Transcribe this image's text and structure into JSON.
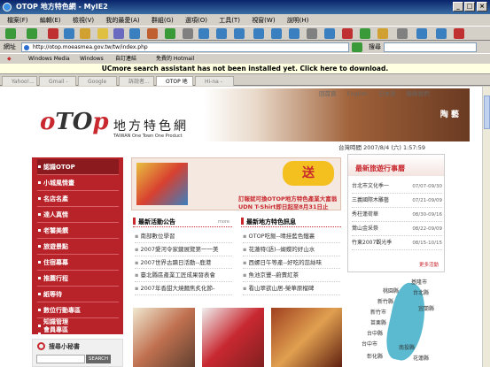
{
  "window": {
    "title": "OTOP 地方特色網 - MyIE2"
  },
  "menu": [
    "檔案(F)",
    "編輯(E)",
    "檢視(V)",
    "我的最愛(A)",
    "群組(G)",
    "選項(O)",
    "工具(T)",
    "視窗(W)",
    "說明(H)"
  ],
  "address": {
    "label": "網址",
    "url": "http://otop.moeasmea.gov.tw/tw/index.php",
    "search_label": "搜尋"
  },
  "links": [
    "Windows Media",
    "Windows",
    "自訂連結",
    "免費的 Hotmail"
  ],
  "infobar": "UCmore search assistant has not been installed yet. Click here to download.",
  "tabs": [
    "Yahoo!...",
    "Gmail - R...",
    "Google R...",
    "訴說者...",
    "OTOP 地方...",
    "Hi-na - Pu..."
  ],
  "site": {
    "topnav": [
      "回首頁",
      "English",
      "日本語",
      "聯絡我們"
    ],
    "logo_o": "o",
    "logo_t": "TO",
    "logo_p": "p",
    "name": "地方特色網",
    "tagline": "TAIWAN One Town One Product",
    "banner_text": "陶 藝",
    "clock": "台灣時間 2007/8/4 (六) 1:57:59"
  },
  "leftnav": [
    "認識OTOP",
    "小城風情畫",
    "名店名產",
    "達人真情",
    "老饕美饌",
    "旅遊景點",
    "住宿幕幕",
    "推薦行程",
    "紙等待",
    "數位行動專區",
    "知識管理",
    "會員專區"
  ],
  "promo": {
    "badge": "送",
    "line1": "訂報就可換OTOP地方特色產業大富翁",
    "line2": "UDN T-Shirt即日起至8月31日止"
  },
  "news": {
    "heading": "最新活動公告",
    "more": "more",
    "items": [
      "南部數位學習",
      "2007愛河令家鍵展覽第一一美",
      "2007世界古蹟日活動--鹿港",
      "臺北縣區產業工匠成果發表會",
      "2007年香甜大燒麵焦炙化節-"
    ]
  },
  "specials": {
    "heading": "最新地方特色訊息",
    "items": [
      "OTOP吃飯--晴挂藍色鐵裏",
      "花蓮特(語)--蝴蝶的好山水",
      "西螺日午等產--好吃的蕊絲味",
      "魚池京豐--蔚賣紅茶",
      "看山翠欲山居-榮華原榴碑"
    ]
  },
  "search": {
    "label": "搜尋小秘書",
    "button": "SEARCH"
  },
  "travel": {
    "heading": "最新旅遊行事曆",
    "items": [
      {
        "name": "台北市文化季一",
        "date": "07/07-09/30"
      },
      {
        "name": "三義國際木雕藝",
        "date": "07/21-09/09"
      },
      {
        "name": "秀柱蓮荷華",
        "date": "08/30-09/16"
      },
      {
        "name": "鶯山金采祭",
        "date": "08/22-09/09"
      },
      {
        "name": "竹東2007觀光季",
        "date": "08/15-10/15"
      }
    ],
    "more": "更多活動"
  },
  "map": {
    "labels": [
      "基隆市",
      "桃園縣",
      "台北縣",
      "新竹縣",
      "新竹市",
      "苗栗縣",
      "台中縣",
      "台中市",
      "宜蘭縣",
      "南投縣",
      "彰化縣",
      "花蓮縣"
    ]
  }
}
